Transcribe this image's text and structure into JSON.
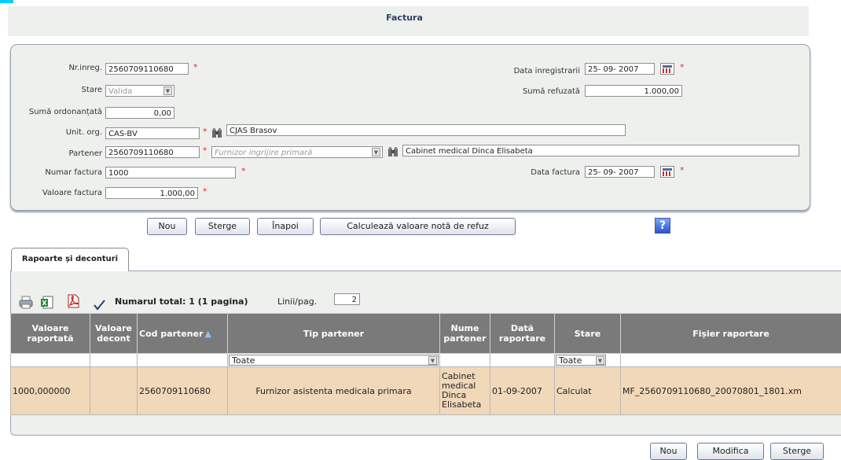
{
  "form": {
    "title": "Factura",
    "fields": {
      "nr_inreg": {
        "label": "Nr.inreg.",
        "value": "2560709110680"
      },
      "stare": {
        "label": "Stare",
        "value": "Valida"
      },
      "suma_ordonantata": {
        "label": "Sumă ordonanțată",
        "value": "0,00"
      },
      "unit_org": {
        "label": "Unit. org.",
        "value": "CAS-BV",
        "name": "CJAS Brasov"
      },
      "partener": {
        "label": "Partener",
        "value": "2560709110680",
        "type": "Furnizor ingrijire primară",
        "name": "Cabinet medical Dinca Elisabeta"
      },
      "numar_factura": {
        "label": "Numar factura",
        "value": "1000"
      },
      "valoare_factura": {
        "label": "Valoare factura",
        "value": "1.000,00"
      },
      "data_inregistrarii": {
        "label": "Data inregistrarii",
        "value": "25- 09-  2007"
      },
      "suma_refuzata": {
        "label": "Sumă refuzată",
        "value": "1.000,00"
      },
      "data_factura": {
        "label": "Data factura",
        "value": "25- 09-  2007"
      }
    },
    "required_mark": "*",
    "buttons": {
      "nou": "Nou",
      "sterge": "Sterge",
      "inapoi": "Înapoi",
      "calculeaza": "Calculează valoare notă de refuz"
    },
    "help": "?"
  },
  "tab": {
    "label": "Rapoarte și deconturi"
  },
  "toolbar": {
    "total_label": "Numarul total: 1 (1 pagina)",
    "lines_label": "Linii/pag.",
    "lines_value": "2",
    "icons": [
      "print-icon",
      "excel-icon",
      "pdf-icon",
      "check-icon"
    ]
  },
  "table": {
    "columns": [
      "Valoare raportată",
      "Valoare decont",
      "Cod partener",
      "Tip partener",
      "Nume partener",
      "Dată raportare",
      "Stare",
      "Fișier raportare"
    ],
    "sort_indicator": "▲",
    "filters": {
      "tip_partener": "Toate",
      "stare": "Toate"
    },
    "rows": [
      [
        "1000,000000",
        "",
        "2560709110680",
        "Furnizor asistenta medicala primara",
        "Cabinet medical Dinca Elisabeta",
        "01-09-2007",
        "Calculat",
        "MF_2560709110680_20070801_1801.xm"
      ]
    ]
  },
  "bottom_buttons": {
    "nou": "Nou",
    "modifica": "Modifica",
    "sterge": "Sterge"
  },
  "colors": {
    "header_bg": "#7a7a7a",
    "row_bg": "#f1d8b9",
    "panel_bg": "#eef0ee",
    "title_color": "#2c3f66",
    "required": "#e0302c"
  }
}
